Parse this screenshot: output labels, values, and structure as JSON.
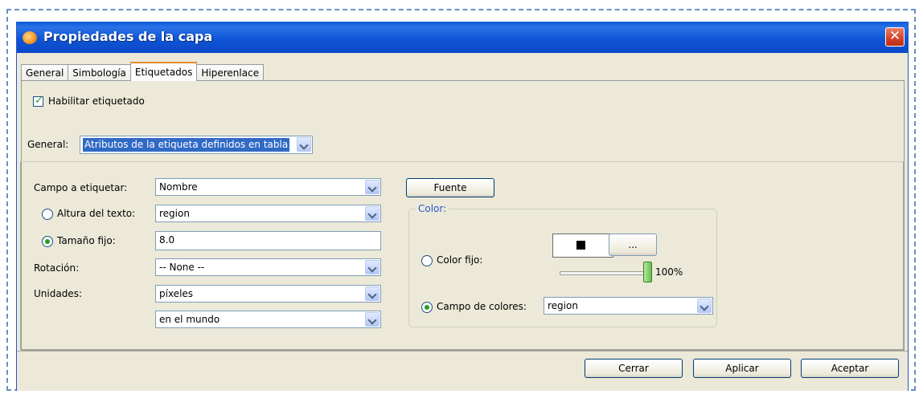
{
  "window": {
    "title": "Propiedades de la capa",
    "close_symbol": "✕"
  },
  "tabs": [
    {
      "label": "General",
      "active": false
    },
    {
      "label": "Simbología",
      "active": false
    },
    {
      "label": "Etiquetados",
      "active": true
    },
    {
      "label": "Hiperenlace",
      "active": false
    }
  ],
  "labeling": {
    "enable_checkbox": {
      "label": "Habilitar etiquetado",
      "checked": true
    },
    "general": {
      "label": "General:",
      "value": "Atributos de la etiqueta definidos en tabla"
    },
    "field_to_label": {
      "label": "Campo a etiquetar:",
      "value": "Nombre"
    },
    "text_height": {
      "label": "Altura del texto:",
      "value": "region",
      "selected": false
    },
    "fixed_size": {
      "label": "Tamaño fijo:",
      "value": "8.0",
      "selected": true
    },
    "rotation": {
      "label": "Rotación:",
      "value": "-- None --"
    },
    "units": {
      "label": "Unidades:",
      "value": "píxeles",
      "value2": "en el mundo"
    },
    "font_button": "Fuente"
  },
  "color": {
    "group_title": "Color:",
    "fixed_color": {
      "label": "Color fijo:",
      "selected": false,
      "swatch_color": "#000000",
      "picker_label": "..."
    },
    "transparency": {
      "value_label": "100%",
      "level": 1.0
    },
    "color_field": {
      "label": "Campo de colores:",
      "value": "region",
      "selected": true
    }
  },
  "footer": {
    "close": "Cerrar",
    "apply": "Aplicar",
    "accept": "Aceptar"
  },
  "colors": {
    "title_bar": "#0b55d6",
    "dialog_bg": "#ece9d8",
    "selection": "#316ac5",
    "check_green": "#21a121",
    "tab_accent": "#e68b2c"
  }
}
